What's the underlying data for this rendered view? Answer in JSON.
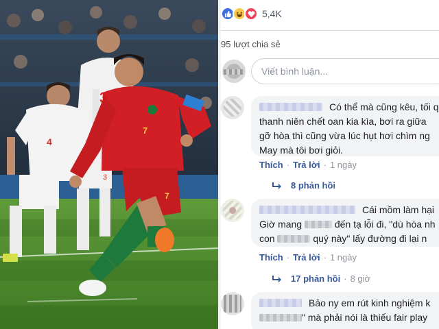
{
  "post": {
    "reaction_icons": [
      "like-icon",
      "haha-icon",
      "love-icon"
    ],
    "reaction_count": "5,4K",
    "share_count_text": "95 lượt chia sẻ",
    "photo": {
      "subject": "penalty-kick-photo",
      "jersey_number": "7",
      "opponent_numbers": [
        "3",
        "4"
      ]
    }
  },
  "composer": {
    "placeholder": "Viết bình luận..."
  },
  "comments": [
    {
      "lines": [
        "Có thể mà cũng kêu, tối q",
        "thanh niên chết oan kia kìa, bơi ra giữa",
        "gỡ hòa thì cũng vừa lúc hụt hơi chìm ng",
        "May mà tôi bơi giỏi."
      ],
      "actions": {
        "like": "Thích",
        "reply": "Trả lời",
        "time": "1 ngày"
      },
      "replies_text": "8 phản hồi",
      "replies_time": ""
    },
    {
      "lines": [
        "Cái mồm làm hại",
        "Giờ mang",
        "đến tạ lỗi đi, \"dù hòa nh",
        "con",
        "quý này\" lấy đường đi lại n"
      ],
      "actions": {
        "like": "Thích",
        "reply": "Trả lời",
        "time": "1 ngày"
      },
      "replies_text": "17 phản hồi",
      "replies_time": "8 giờ"
    },
    {
      "lines": [
        "Bảo ny em rút kinh nghiệm k",
        "\" mà phải nói là thiếu fair play"
      ]
    }
  ],
  "colors": {
    "link": "#385898",
    "bubble": "#f2f3f5",
    "meta": "#90949c",
    "like_blue": "#3b6ee0",
    "love_red": "#f0435a",
    "haha_yellow": "#f7c94b"
  }
}
